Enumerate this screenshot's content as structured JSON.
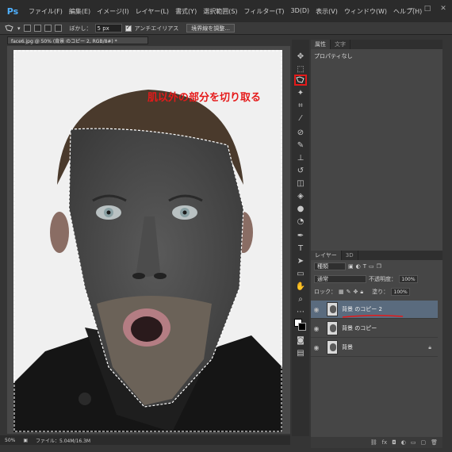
{
  "app": {
    "logo": "Ps"
  },
  "menu": [
    "ファイル(F)",
    "編集(E)",
    "イメージ(I)",
    "レイヤー(L)",
    "書式(Y)",
    "選択範囲(S)",
    "フィルター(T)",
    "3D(D)",
    "表示(V)",
    "ウィンドウ(W)",
    "ヘルプ(H)"
  ],
  "window_controls": {
    "minimize": "—",
    "maximize": "□",
    "close": "✕"
  },
  "options": {
    "feather_label": "ぼかし：",
    "feather_value": "5 px",
    "antialias_label": "アンチエイリアス",
    "refine_button": "境界線を調整..."
  },
  "document": {
    "tab_title": "face6.jpg @ 50% (背景 のコピー 2, RGB/8#) *"
  },
  "annotation": "肌以外の部分を切り取る",
  "status": {
    "zoom": "50%",
    "file_info": "ファイル：5.04M/16.3M"
  },
  "panel": {
    "tabs": [
      "属性",
      "文字"
    ],
    "properties_text": "プロパティなし"
  },
  "layers_panel": {
    "tabs": [
      "レイヤー",
      "3D"
    ],
    "filter_label": "種類",
    "blend_mode": "通常",
    "opacity_label": "不透明度：",
    "opacity_value": "100%",
    "lock_label": "ロック：",
    "fill_label": "塗り：",
    "fill_value": "100%",
    "layers": [
      {
        "name": "背景 のコピー 2",
        "active": true
      },
      {
        "name": "背景 のコピー",
        "active": false
      },
      {
        "name": "背景",
        "active": false
      }
    ],
    "bottom_icons": [
      "link-icon",
      "fx-icon",
      "mask-icon",
      "adjustment-icon",
      "group-icon",
      "new-layer-icon",
      "trash-icon"
    ]
  },
  "colors": {
    "annotation": "#e51a1a",
    "selected_layer": "#5a6b7e",
    "accent": "#4fb1ff"
  }
}
